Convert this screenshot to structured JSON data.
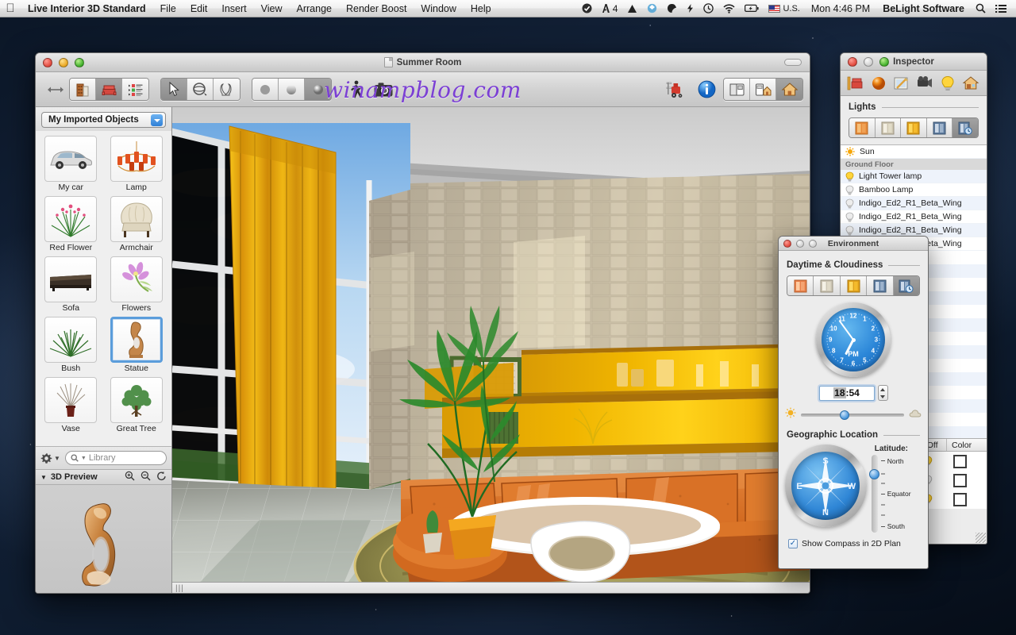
{
  "menubar": {
    "apple": "apple-logo",
    "app_name": "Live Interior 3D Standard",
    "menus": [
      "File",
      "Edit",
      "Insert",
      "View",
      "Arrange",
      "Render Boost",
      "Window",
      "Help"
    ],
    "status_items": [
      {
        "name": "checkmark-status-icon",
        "glyph": "✔"
      },
      {
        "name": "adobe-status-icon",
        "glyph": "A",
        "badge": "4"
      },
      {
        "name": "google-drive-icon",
        "glyph": "▲"
      },
      {
        "name": "dropbox-icon",
        "glyph": "◆"
      },
      {
        "name": "evernote-icon",
        "glyph": "●"
      },
      {
        "name": "flash-icon",
        "glyph": "⚡"
      },
      {
        "name": "time-machine-icon",
        "glyph": "↺"
      },
      {
        "name": "wifi-icon",
        "glyph": "◔"
      },
      {
        "name": "battery-icon",
        "glyph": "▭"
      }
    ],
    "input_source": "U.S.",
    "clock": "Mon 4:46 PM",
    "user": "BeLight Software",
    "spotlight": "search-icon",
    "notification_center": "list-icon"
  },
  "app_window": {
    "title": "Summer Room",
    "watermark": "winampblog.com",
    "toolbar": {
      "resize_handle": "resize-arrows-icon",
      "view_group": [
        {
          "name": "building-2d-icon",
          "selected": false
        },
        {
          "name": "furniture-3d-icon",
          "selected": true
        },
        {
          "name": "list-view-icon",
          "selected": false
        }
      ],
      "tool_group": [
        {
          "name": "arrow-select-tool",
          "selected": false
        },
        {
          "name": "orbit-tool",
          "selected": false
        },
        {
          "name": "walk-tool",
          "selected": false
        }
      ],
      "render_group": [
        {
          "name": "solid-shading-icon",
          "selected": false
        },
        {
          "name": "gradient-shading-icon",
          "selected": false
        },
        {
          "name": "realistic-shading-icon",
          "selected": true
        }
      ],
      "walkthrough": "walk-person-icon",
      "camera": "camera-icon",
      "truck": "forklift-import-icon",
      "info": "info-icon",
      "layout_group": [
        {
          "name": "split-view-icon",
          "selected": false
        },
        {
          "name": "elevation-view-icon",
          "selected": false
        },
        {
          "name": "home-view-icon",
          "selected": true
        }
      ]
    },
    "sidebar": {
      "library_popup": "My Imported Objects",
      "objects": [
        {
          "label": "My car",
          "icon": "car-thumb",
          "selected": false
        },
        {
          "label": "Lamp",
          "icon": "chandelier-thumb",
          "selected": false
        },
        {
          "label": "Red Flower",
          "icon": "red-flower-thumb",
          "selected": false
        },
        {
          "label": "Armchair",
          "icon": "armchair-thumb",
          "selected": false
        },
        {
          "label": "Sofa",
          "icon": "sofa-thumb",
          "selected": false
        },
        {
          "label": "Flowers",
          "icon": "flowers-thumb",
          "selected": false
        },
        {
          "label": "Bush",
          "icon": "bush-thumb",
          "selected": false
        },
        {
          "label": "Statue",
          "icon": "statue-thumb",
          "selected": true
        },
        {
          "label": "Vase",
          "icon": "vase-thumb",
          "selected": false
        },
        {
          "label": "Great Tree",
          "icon": "tree-thumb",
          "selected": false
        }
      ],
      "gear_menu": "gear-icon",
      "search_placeholder": "Library",
      "preview_header": "3D Preview",
      "preview_zoom_in": "zoom-in-icon",
      "preview_zoom_out": "zoom-out-icon",
      "preview_rotate": "rotate-icon"
    }
  },
  "inspector": {
    "title": "Inspector",
    "tabs": [
      {
        "name": "object-tab",
        "selected": false
      },
      {
        "name": "material-tab",
        "selected": false
      },
      {
        "name": "texture-tab",
        "selected": false
      },
      {
        "name": "camera-tab",
        "selected": false
      },
      {
        "name": "light-tab",
        "selected": false
      },
      {
        "name": "environment-tab",
        "selected": false
      }
    ],
    "section_title": "Lights",
    "light_presets": [
      {
        "name": "preset-warm",
        "selected": false
      },
      {
        "name": "preset-neutral",
        "selected": false
      },
      {
        "name": "preset-sunny",
        "selected": false
      },
      {
        "name": "preset-cool",
        "selected": false
      },
      {
        "name": "preset-time",
        "selected": true
      }
    ],
    "lights": [
      {
        "label": "Sun",
        "icon": "sun-icon",
        "group": false
      },
      {
        "label": "Ground Floor",
        "icon": "",
        "group": true
      },
      {
        "label": "Light Tower lamp",
        "icon": "bulb-on-icon",
        "group": false
      },
      {
        "label": "Bamboo Lamp",
        "icon": "bulb-off-icon",
        "group": false
      },
      {
        "label": "Indigo_Ed2_R1_Beta_Wing",
        "icon": "bulb-off-icon",
        "group": false
      },
      {
        "label": "Indigo_Ed2_R1_Beta_Wing",
        "icon": "bulb-off-icon",
        "group": false
      },
      {
        "label": "Indigo_Ed2_R1_Beta_Wing",
        "icon": "bulb-off-icon",
        "group": false
      },
      {
        "label": "Indigo_Ed2_R1_Beta_Wing",
        "icon": "bulb-off-icon",
        "group": false
      }
    ],
    "table_columns": [
      "On|Off",
      "Color"
    ],
    "table_rows": [
      {
        "on": "bulb-on-icon",
        "color": "#ffffff"
      },
      {
        "on": "bulb-off-icon",
        "color": "#ffffff"
      },
      {
        "on": "bulb-on-icon",
        "color": "#ffffff"
      }
    ]
  },
  "environment": {
    "title": "Environment",
    "daytime_title": "Daytime & Cloudiness",
    "daytime_presets": [
      {
        "name": "preset-sunrise",
        "selected": false
      },
      {
        "name": "preset-overcast",
        "selected": false
      },
      {
        "name": "preset-midday",
        "selected": false
      },
      {
        "name": "preset-night",
        "selected": false
      },
      {
        "name": "preset-custom-time",
        "selected": true
      }
    ],
    "clock": {
      "name": "analog-clock",
      "meridiem": "PM",
      "numbers": [
        "12",
        "1",
        "2",
        "3",
        "4",
        "5",
        "6",
        "7",
        "8",
        "9",
        "10",
        "11"
      ],
      "hour_angle": 207,
      "minute_angle": 324
    },
    "time_value": "18:54",
    "time_hours": "18",
    "time_sep": ":",
    "time_minutes": "54",
    "cloud_slider": {
      "left_icon": "sun-icon",
      "right_icon": "cloud-icon",
      "position_pct": 42
    },
    "geo_title": "Geographic Location",
    "compass": "compass-dial",
    "compass_points": [
      "N",
      "E",
      "S",
      "W"
    ],
    "latitude_label": "Latitude:",
    "latitude_ticks": [
      "North",
      "Equator",
      "South"
    ],
    "latitude_knob_pct": 18,
    "show_compass_label": "Show Compass in 2D Plan",
    "show_compass_checked": true,
    "checkmark": "✓"
  },
  "colors": {
    "accent_blue": "#2f86d6",
    "selection_blue": "#5b9ddb",
    "curtain_yellow": "#e9a207",
    "sofa_orange": "#d1691f",
    "watermark_purple": "#7b3fd4",
    "desktop_navy": "#0d1a2c"
  }
}
